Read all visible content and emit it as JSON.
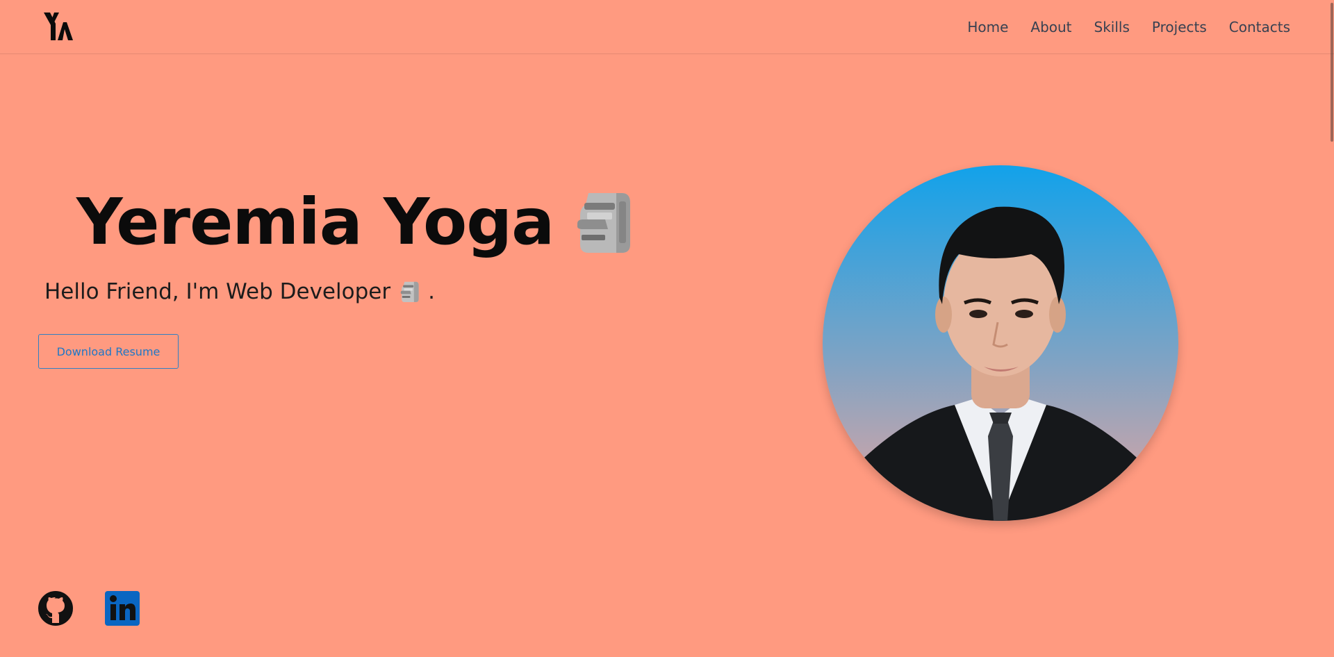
{
  "nav": {
    "logo_text": "YA",
    "items": [
      {
        "label": "Home"
      },
      {
        "label": "About"
      },
      {
        "label": "Skills"
      },
      {
        "label": "Projects"
      },
      {
        "label": "Contacts"
      }
    ]
  },
  "hero": {
    "name": "Yeremia Yoga",
    "name_icon": "moai-icon",
    "subtitle": "Hello Friend, I'm Web Developer",
    "subtitle_suffix": ".",
    "subtitle_icon": "moai-icon",
    "resume_button": "Download Resume"
  },
  "profile": {
    "photo": "profile-photo"
  },
  "social": {
    "github_icon": "github-icon",
    "linkedin_icon": "linkedin-icon"
  },
  "colors": {
    "background": "#FF9A80",
    "nav_text": "#374151",
    "accent": "#1f77c6",
    "linkedin": "#0A66C2"
  }
}
